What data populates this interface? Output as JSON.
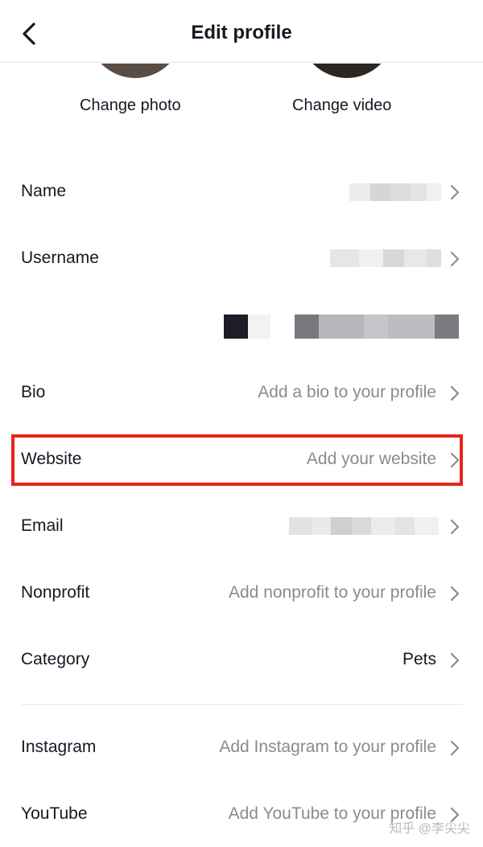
{
  "header": {
    "title": "Edit profile"
  },
  "media": {
    "photo_label": "Change photo",
    "video_label": "Change video"
  },
  "rows": {
    "name": {
      "label": "Name"
    },
    "username": {
      "label": "Username"
    },
    "bio": {
      "label": "Bio",
      "value": "Add a bio to your profile"
    },
    "website": {
      "label": "Website",
      "value": "Add your website"
    },
    "email": {
      "label": "Email"
    },
    "nonprofit": {
      "label": "Nonprofit",
      "value": "Add nonprofit to your profile"
    },
    "category": {
      "label": "Category",
      "value": "Pets"
    },
    "instagram": {
      "label": "Instagram",
      "value": "Add Instagram to your profile"
    },
    "youtube": {
      "label": "YouTube",
      "value": "Add YouTube to your profile"
    }
  },
  "icons": {
    "back": "chevron-left-icon",
    "row_arrow": "chevron-right-icon"
  },
  "colors": {
    "highlight": "#e8251a",
    "muted_text": "#8a8b91",
    "primary_text": "#161823"
  },
  "watermark": "知乎 @李尖尖"
}
